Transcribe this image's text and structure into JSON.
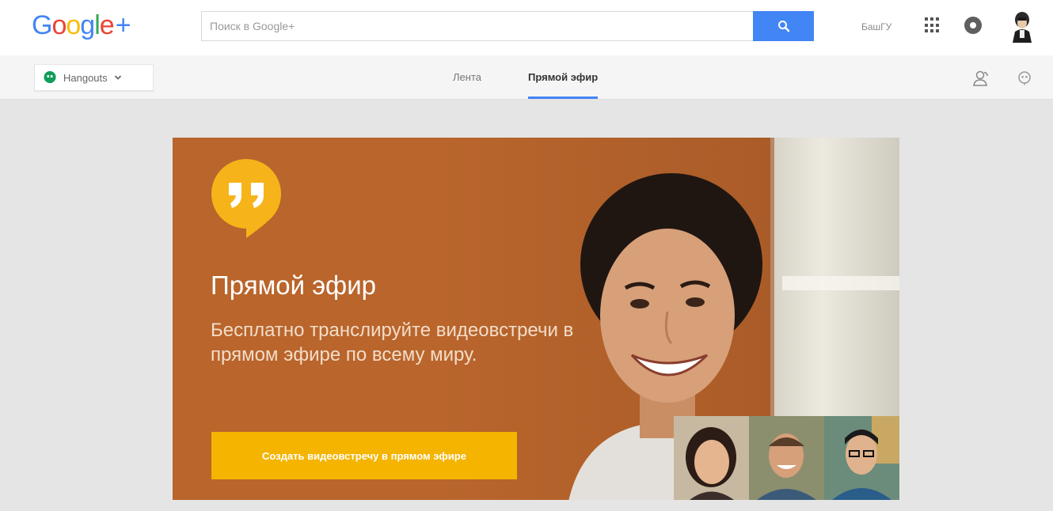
{
  "header": {
    "logo_text": "Google+",
    "search_placeholder": "Поиск в Google+",
    "account_label": "БашГУ",
    "icons": [
      "search-icon",
      "apps-grid-icon",
      "notifications-icon",
      "avatar"
    ]
  },
  "subnav": {
    "hangouts_label": "Hangouts",
    "tabs": [
      {
        "label": "Лента",
        "active": false
      },
      {
        "label": "Прямой эфир",
        "active": true
      }
    ],
    "right_icons": [
      "people-icon",
      "hangouts-icon"
    ]
  },
  "hero": {
    "title": "Прямой эфир",
    "subtitle": "Бесплатно транслируйте видеовстречи в прямом эфире по всему миру.",
    "cta_label": "Создать видеовстречу в прямом эфире"
  },
  "colors": {
    "accent": "#4285f4",
    "hero_bg": "#b9652c",
    "cta_bg": "#f4b400",
    "hangouts_green": "#0f9d58"
  }
}
